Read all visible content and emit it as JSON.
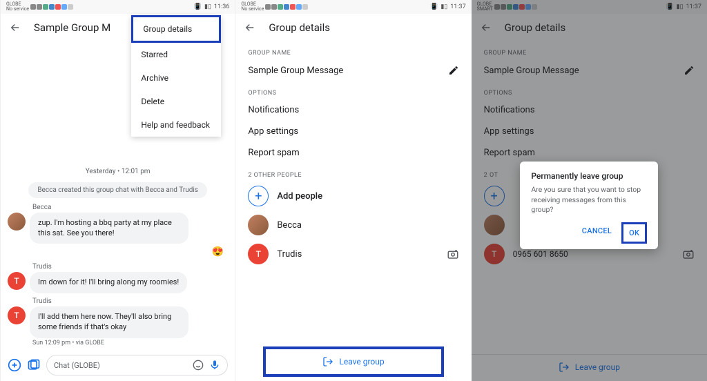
{
  "status": {
    "carrier": "GLOBE",
    "carrier_sub": "No service",
    "carrier3": "GLOBE",
    "carrier3_sub": "SMART",
    "time1": "11:36",
    "time2": "11:37",
    "time3": "11:37"
  },
  "screen1": {
    "title": "Sample Group M",
    "menu": {
      "details": "Group details",
      "starred": "Starred",
      "archive": "Archive",
      "delete": "Delete",
      "help": "Help and feedback"
    },
    "date_sep": "Yesterday • 12:01 pm",
    "system_msg": "Becca created this group chat with Becca and Trudis",
    "msg1": {
      "sender": "Becca",
      "text": "zup. I'm hosting a bbq party at my place this sat. See you there!"
    },
    "reaction": "😍",
    "msg2": {
      "sender": "Trudis",
      "text": "Im down for it! I'll bring along my roomies!"
    },
    "msg3": {
      "sender": "Trudis",
      "text": "I'll add them here now. They'll also bring some friends if that's okay"
    },
    "msg3_meta": "Sun 12:09 pm • via GLOBE",
    "compose_placeholder": "Chat (GLOBE)"
  },
  "screen2": {
    "title": "Group details",
    "section_group_name": "GROUP NAME",
    "group_name": "Sample Group Message",
    "section_options": "OPTIONS",
    "opt_notifications": "Notifications",
    "opt_app_settings": "App settings",
    "opt_report_spam": "Report spam",
    "section_people": "2 OTHER PEOPLE",
    "add_people": "Add people",
    "person1": "Becca",
    "person2": "Trudis",
    "person2_initial": "T",
    "leave_group": "Leave group"
  },
  "screen3": {
    "title": "Group details",
    "section_group_name": "GROUP NAME",
    "group_name": "Sample Group Message",
    "section_options": "OPTIONS",
    "opt_notifications": "Notifications",
    "opt_app_settings": "App settings",
    "opt_report_spam": "Report spam",
    "section_people": "2 OT",
    "add_people": "",
    "person2_initial": "T",
    "phone": "0965 601 8650",
    "leave_group": "Leave group",
    "dialog": {
      "title": "Permanently leave group",
      "body": "Are you sure that you want to stop receiving messages from this group?",
      "cancel": "CANCEL",
      "ok": "OK"
    }
  }
}
